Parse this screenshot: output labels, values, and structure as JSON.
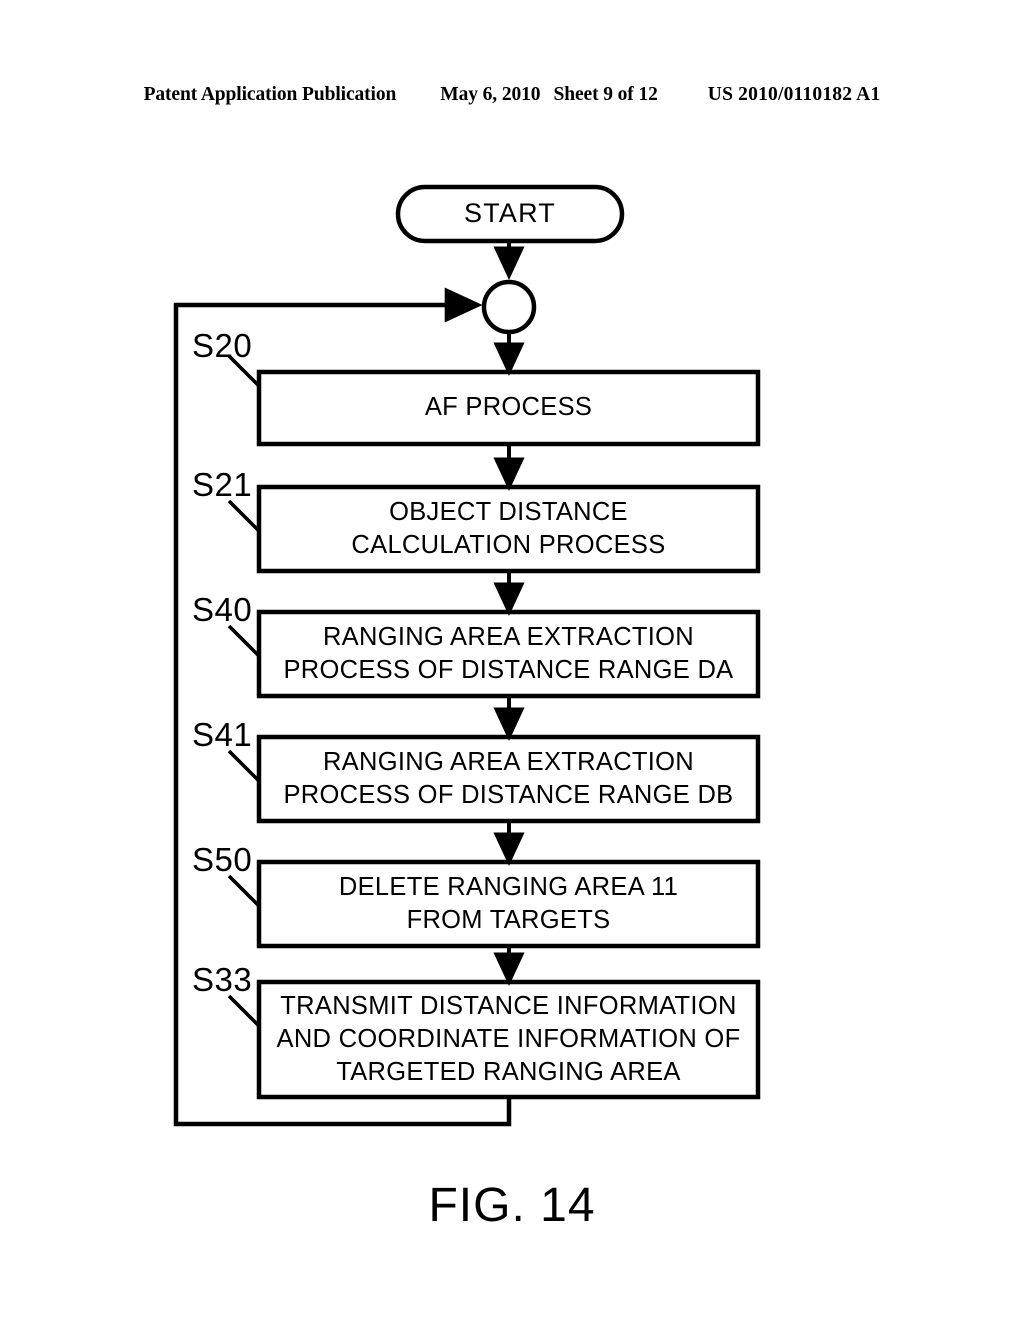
{
  "header": {
    "publication": "Patent Application Publication",
    "date": "May 6, 2010",
    "sheet": "Sheet 9 of 12",
    "patent_number": "US 2010/0110182 A1"
  },
  "figure": {
    "caption": "FIG. 14",
    "terminal_start": "START",
    "junction_label": "",
    "steps": [
      {
        "id": "S20",
        "text": "AF PROCESS"
      },
      {
        "id": "S21",
        "text": "OBJECT DISTANCE\nCALCULATION PROCESS"
      },
      {
        "id": "S40",
        "text": "RANGING AREA EXTRACTION\nPROCESS OF DISTANCE RANGE DA"
      },
      {
        "id": "S41",
        "text": "RANGING AREA EXTRACTION\nPROCESS OF DISTANCE RANGE DB"
      },
      {
        "id": "S50",
        "text": "DELETE RANGING AREA 11\nFROM TARGETS"
      },
      {
        "id": "S33",
        "text": "TRANSMIT DISTANCE INFORMATION\nAND COORDINATE INFORMATION OF\nTARGETED RANGING AREA"
      }
    ]
  },
  "colors": {
    "ink": "#000000",
    "paper": "#ffffff"
  }
}
